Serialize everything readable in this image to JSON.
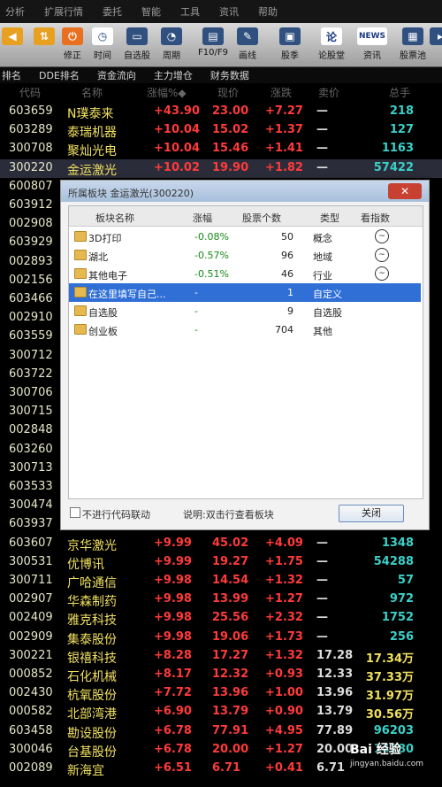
{
  "menu": [
    "分析",
    "扩展行情",
    "委托",
    "智能",
    "工具",
    "资讯",
    "帮助"
  ],
  "toolbar": [
    {
      "label": "",
      "icon": "back-arrow-icon",
      "sym": "◀",
      "color": "#e8a020"
    },
    {
      "label": "",
      "icon": "up-down-icon",
      "sym": "⇅",
      "color": "#e8a020"
    },
    {
      "label": "修正",
      "icon": "power-icon",
      "sym": "⏻",
      "color": "#e87020"
    },
    {
      "label": "时间",
      "icon": "clock-icon",
      "sym": "◷",
      "color": "#ffffff"
    },
    {
      "label": "自选股",
      "icon": "monitor-icon",
      "sym": "▭",
      "color": "#305080"
    },
    {
      "label": "周期",
      "icon": "timer-icon",
      "sym": "◔",
      "color": "#305080"
    },
    {
      "label": "F10/F9",
      "icon": "window-icon",
      "sym": "▤",
      "color": "#305080"
    },
    {
      "label": "画线",
      "icon": "pen-icon",
      "sym": "✎",
      "color": "#305080"
    },
    {
      "label": "股季",
      "icon": "screen-icon",
      "sym": "▣",
      "color": "#305080"
    },
    {
      "label": "论股堂",
      "icon": "forum-icon",
      "sym": "论",
      "color": "#ffffff"
    },
    {
      "label": "资讯",
      "icon": "news-icon",
      "sym": "NEWS",
      "color": "#ffffff"
    },
    {
      "label": "股票池",
      "icon": "chart-icon",
      "sym": "▦",
      "color": "#305080"
    },
    {
      "label": "",
      "icon": "more-icon",
      "sym": "▸",
      "color": "#305080"
    }
  ],
  "tabs": [
    "排名",
    "DDE排名",
    "资金流向",
    "主力增仓",
    "财务数据"
  ],
  "columns": [
    "代码",
    "名称",
    "涨幅%◆",
    "现价",
    "涨跌",
    "卖价",
    "总手"
  ],
  "rows": [
    {
      "code": "603659",
      "name": "N璞泰来",
      "pct": "+43.90",
      "price": "23.00",
      "chg": "+7.27",
      "buy": "—",
      "vol": "218"
    },
    {
      "code": "603289",
      "name": "泰瑞机器",
      "pct": "+10.04",
      "price": "15.02",
      "chg": "+1.37",
      "buy": "—",
      "vol": "127"
    },
    {
      "code": "300708",
      "name": "聚灿光电",
      "pct": "+10.04",
      "price": "15.46",
      "chg": "+1.41",
      "buy": "—",
      "vol": "1163"
    },
    {
      "code": "300220",
      "name": "金运激光",
      "pct": "+10.02",
      "price": "19.90",
      "chg": "+1.82",
      "buy": "—",
      "vol": "57422"
    },
    {
      "code": "600807",
      "name": "",
      "pct": "",
      "price": "",
      "chg": "",
      "buy": "",
      "vol": ""
    },
    {
      "code": "603912",
      "name": "",
      "pct": "",
      "price": "",
      "chg": "",
      "buy": "",
      "vol": ""
    },
    {
      "code": "002908",
      "name": "",
      "pct": "",
      "price": "",
      "chg": "",
      "buy": "",
      "vol": ""
    },
    {
      "code": "603929",
      "name": "",
      "pct": "",
      "price": "",
      "chg": "",
      "buy": "",
      "vol": ""
    },
    {
      "code": "002893",
      "name": "",
      "pct": "",
      "price": "",
      "chg": "",
      "buy": "",
      "vol": ""
    },
    {
      "code": "002156",
      "name": "",
      "pct": "",
      "price": "",
      "chg": "",
      "buy": "",
      "vol": ""
    },
    {
      "code": "603466",
      "name": "",
      "pct": "",
      "price": "",
      "chg": "",
      "buy": "",
      "vol": ""
    },
    {
      "code": "002910",
      "name": "",
      "pct": "",
      "price": "",
      "chg": "",
      "buy": "",
      "vol": ""
    },
    {
      "code": "603559",
      "name": "",
      "pct": "",
      "price": "",
      "chg": "",
      "buy": "",
      "vol": ""
    },
    {
      "code": "300712",
      "name": "",
      "pct": "",
      "price": "",
      "chg": "",
      "buy": "",
      "vol": ""
    },
    {
      "code": "603722",
      "name": "",
      "pct": "",
      "price": "",
      "chg": "",
      "buy": "",
      "vol": ""
    },
    {
      "code": "300706",
      "name": "",
      "pct": "",
      "price": "",
      "chg": "",
      "buy": "",
      "vol": ""
    },
    {
      "code": "300715",
      "name": "",
      "pct": "",
      "price": "",
      "chg": "",
      "buy": "",
      "vol": ""
    },
    {
      "code": "002848",
      "name": "",
      "pct": "",
      "price": "",
      "chg": "",
      "buy": "",
      "vol": ""
    },
    {
      "code": "603260",
      "name": "",
      "pct": "",
      "price": "",
      "chg": "",
      "buy": "",
      "vol": ""
    },
    {
      "code": "300713",
      "name": "",
      "pct": "",
      "price": "",
      "chg": "",
      "buy": "",
      "vol": ""
    },
    {
      "code": "603533",
      "name": "",
      "pct": "",
      "price": "",
      "chg": "",
      "buy": "",
      "vol": ""
    },
    {
      "code": "300474",
      "name": "",
      "pct": "",
      "price": "",
      "chg": "",
      "buy": "",
      "vol": ""
    },
    {
      "code": "603937",
      "name": "",
      "pct": "",
      "price": "",
      "chg": "",
      "buy": "",
      "vol": ""
    },
    {
      "code": "603607",
      "name": "京华激光",
      "pct": "+9.99",
      "price": "45.02",
      "chg": "+4.09",
      "buy": "—",
      "vol": "1348"
    },
    {
      "code": "300531",
      "name": "优博讯",
      "pct": "+9.99",
      "price": "19.27",
      "chg": "+1.75",
      "buy": "—",
      "vol": "54288"
    },
    {
      "code": "300711",
      "name": "广哈通信",
      "pct": "+9.98",
      "price": "14.54",
      "chg": "+1.32",
      "buy": "—",
      "vol": "57"
    },
    {
      "code": "002907",
      "name": "华森制药",
      "pct": "+9.98",
      "price": "13.99",
      "chg": "+1.27",
      "buy": "—",
      "vol": "972"
    },
    {
      "code": "002409",
      "name": "雅克科技",
      "pct": "+9.98",
      "price": "25.56",
      "chg": "+2.32",
      "buy": "—",
      "vol": "1752"
    },
    {
      "code": "002909",
      "name": "集泰股份",
      "pct": "+9.98",
      "price": "19.06",
      "chg": "+1.73",
      "buy": "—",
      "vol": "256"
    },
    {
      "code": "300221",
      "name": "银禧科技",
      "pct": "+8.28",
      "price": "17.27",
      "chg": "+1.32",
      "buy": "17.28",
      "vol": "17.34万"
    },
    {
      "code": "000852",
      "name": "石化机械",
      "pct": "+8.17",
      "price": "12.32",
      "chg": "+0.93",
      "buy": "12.33",
      "vol": "37.33万"
    },
    {
      "code": "002430",
      "name": "杭氧股份",
      "pct": "+7.72",
      "price": "13.96",
      "chg": "+1.00",
      "buy": "13.96",
      "vol": "31.97万"
    },
    {
      "code": "000582",
      "name": "北部湾港",
      "pct": "+6.90",
      "price": "13.79",
      "chg": "+0.90",
      "buy": "13.79",
      "vol": "30.56万"
    },
    {
      "code": "603458",
      "name": "勘设股份",
      "pct": "+6.78",
      "price": "77.91",
      "chg": "+4.95",
      "buy": "77.89",
      "vol": "96203"
    },
    {
      "code": "300046",
      "name": "台基股份",
      "pct": "+6.78",
      "price": "20.00",
      "chg": "+1.27",
      "buy": "20.00",
      "vol": "14280"
    },
    {
      "code": "002089",
      "name": "新海宜",
      "pct": "+6.51",
      "price": "6.71",
      "chg": "+0.41",
      "buy": "6.71",
      "vol": ""
    }
  ],
  "dialog": {
    "title": "所属板块  金运激光(300220)",
    "close_x": "✕",
    "headers": [
      "板块名称",
      "涨幅",
      "股票个数",
      "类型",
      "看指数"
    ],
    "rows": [
      {
        "name": "3D打印",
        "pct": "-0.08%",
        "count": "50",
        "type": "概念",
        "eye": true
      },
      {
        "name": "湖北",
        "pct": "-0.57%",
        "count": "96",
        "type": "地域",
        "eye": true
      },
      {
        "name": "其他电子",
        "pct": "-0.51%",
        "count": "46",
        "type": "行业",
        "eye": true
      },
      {
        "name": "在这里填写自己...",
        "pct": "-",
        "count": "1",
        "type": "自定义",
        "eye": false
      },
      {
        "name": "自选股",
        "pct": "-",
        "count": "9",
        "type": "自选股",
        "eye": false
      },
      {
        "name": "创业板",
        "pct": "-",
        "count": "704",
        "type": "其他",
        "eye": false
      }
    ],
    "checkbox_label": "不进行代码联动",
    "hint": "说明:双击行查看板块",
    "close_label": "关闭"
  },
  "watermark": {
    "brand": "Bai 经验",
    "url": "jingyan.baidu.com"
  }
}
